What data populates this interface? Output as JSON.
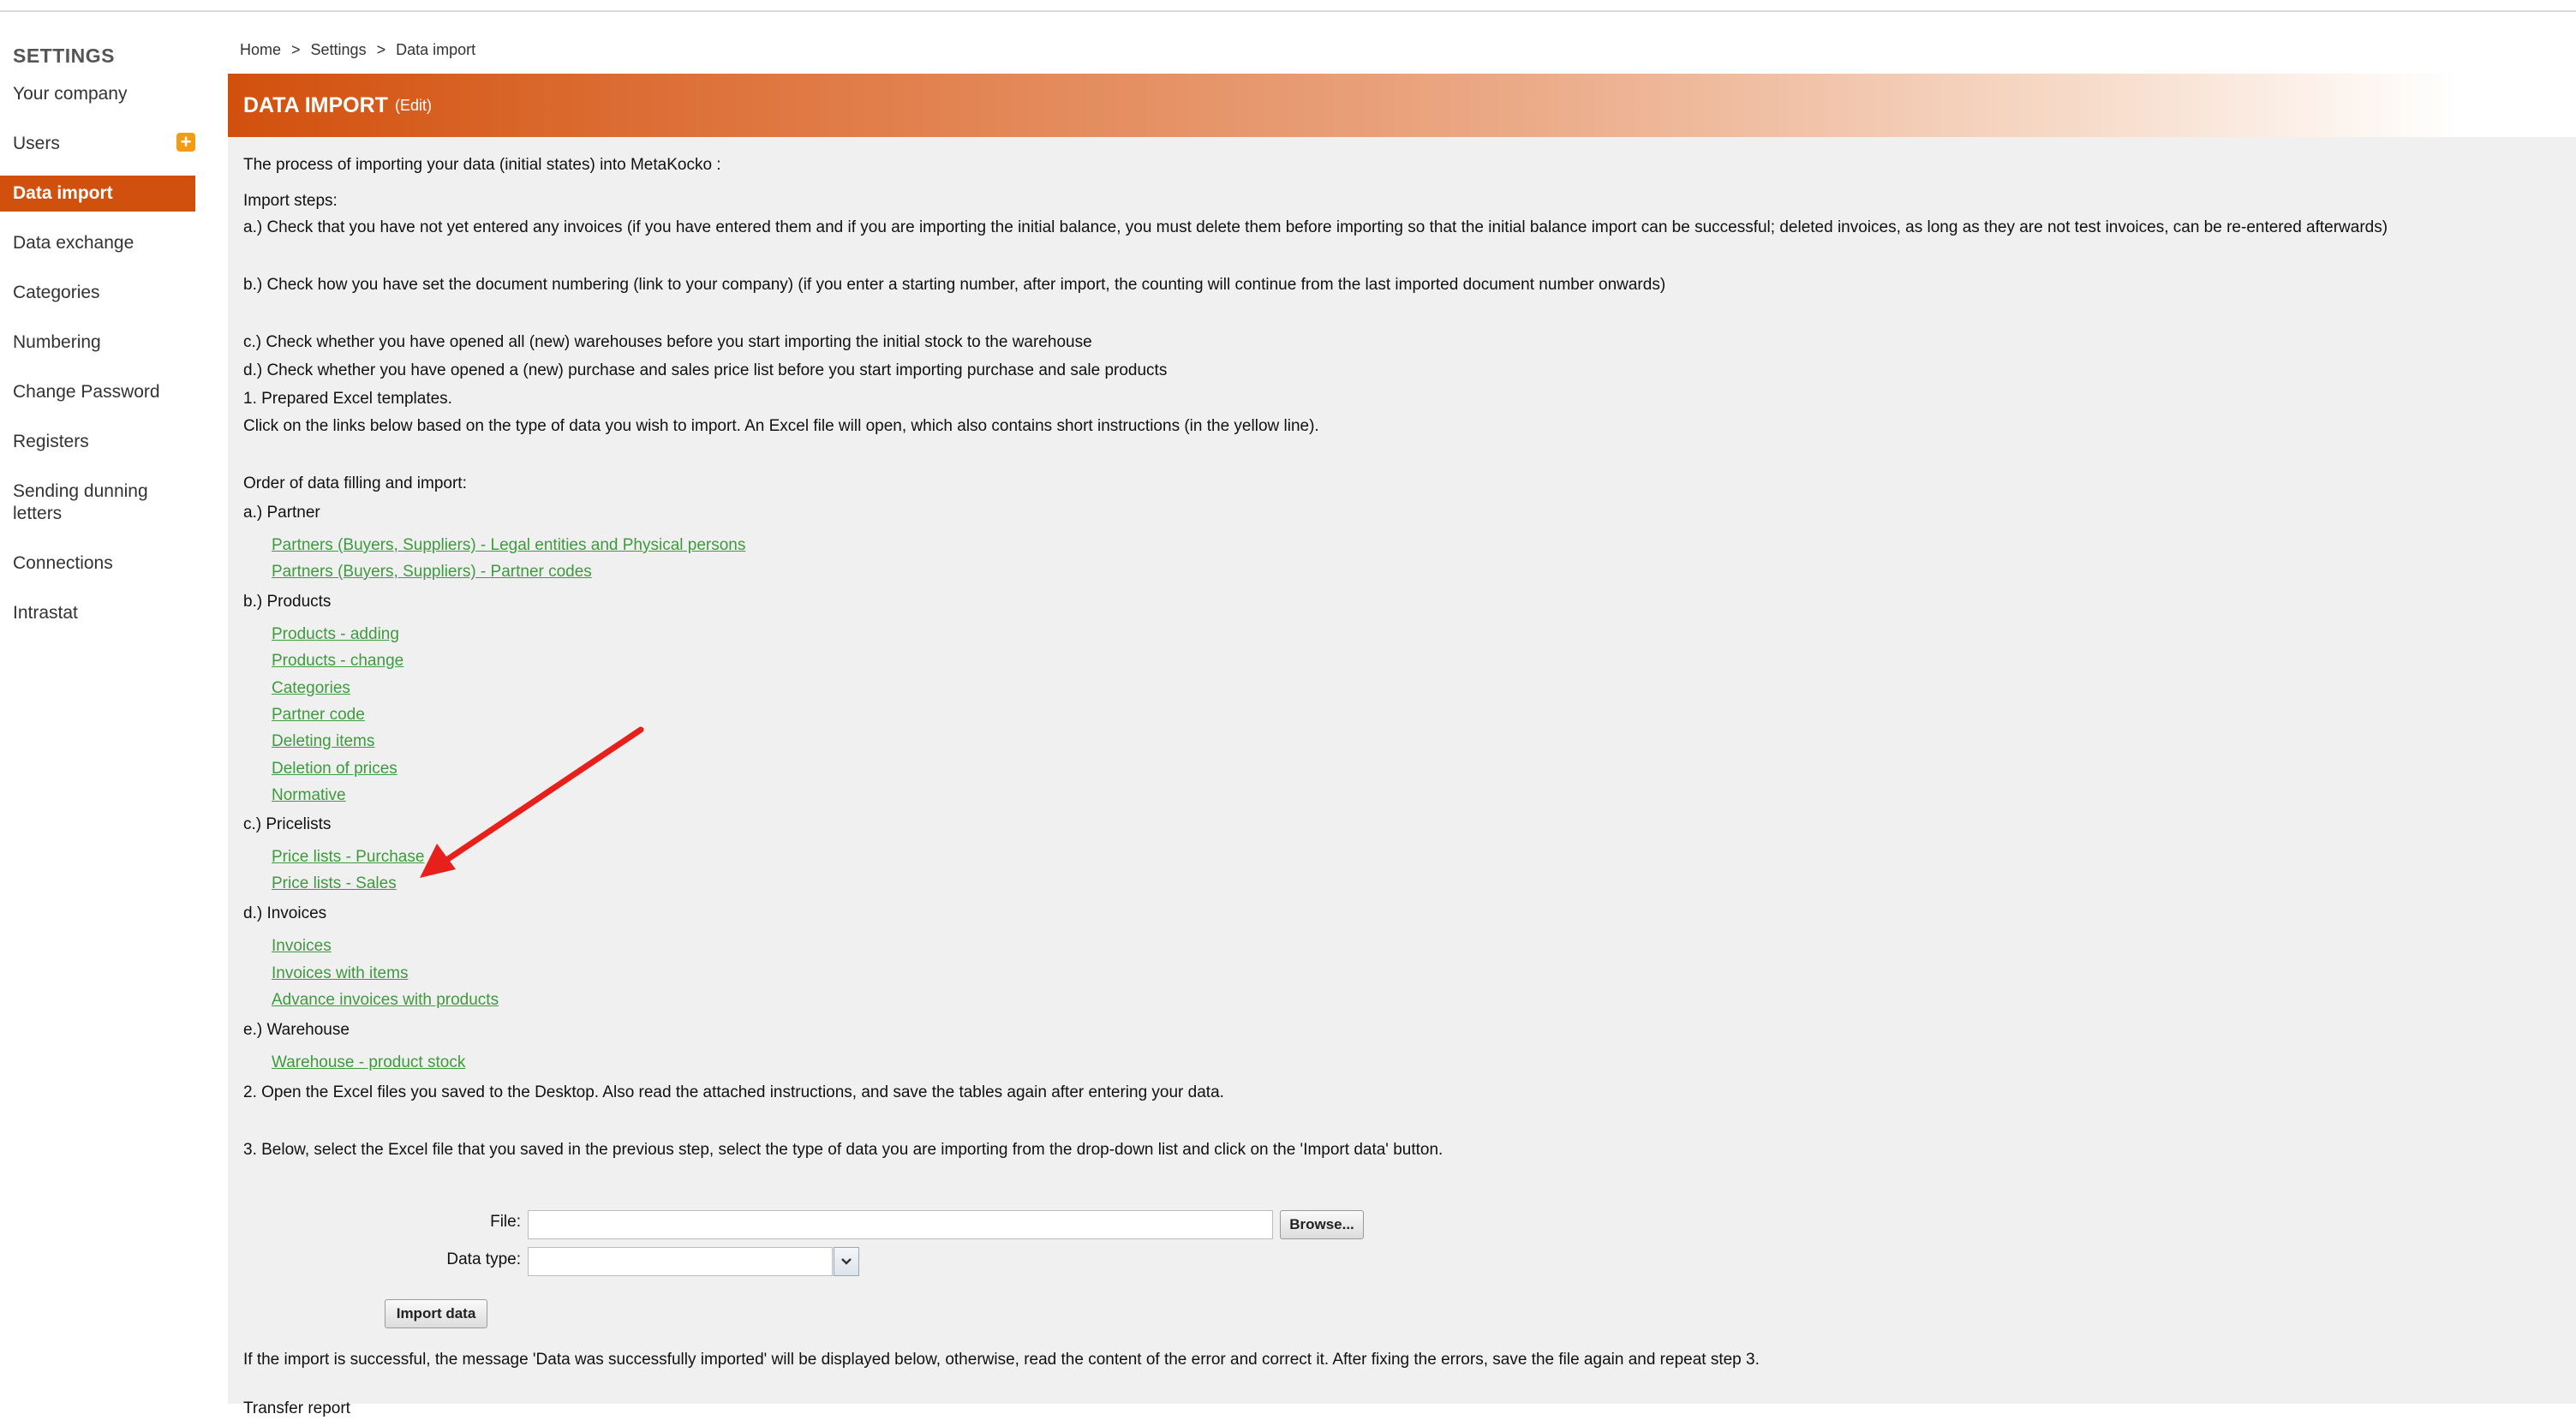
{
  "sidebar": {
    "title": "SETTINGS",
    "items": [
      {
        "label": "Your company"
      },
      {
        "label": "Users"
      },
      {
        "label": "Data import"
      },
      {
        "label": "Data exchange"
      },
      {
        "label": "Categories"
      },
      {
        "label": "Numbering"
      },
      {
        "label": "Change Password"
      },
      {
        "label": "Registers"
      },
      {
        "label": "Sending dunning letters"
      },
      {
        "label": "Connections"
      },
      {
        "label": "Intrastat"
      }
    ],
    "add_icon_glyph": "+"
  },
  "breadcrumb": {
    "home": "Home",
    "settings": "Settings",
    "current": "Data import",
    "separator": ">"
  },
  "header": {
    "title": "DATA IMPORT",
    "edit": "(Edit)"
  },
  "content": {
    "intro": "The process of importing your data (initial states) into MetaKocko :",
    "steps_title": "Import steps:",
    "step_a": "a.) Check that you have not yet entered any invoices (if you have entered them and if you are importing the initial balance, you must delete them before importing so that the initial balance import can be successful; deleted invoices, as long as they are not test invoices, can be re-entered afterwards)",
    "step_b": "b.) Check how you have set the document numbering (link to your company) (if you enter a starting number, after import, the counting will continue from the last imported document number onwards)",
    "step_c": "c.) Check whether you have opened all (new) warehouses before you start importing the initial stock to the warehouse",
    "step_d": "d.) Check whether you have opened a (new) purchase and sales price list before you start importing purchase and sale products",
    "prepared": "1. Prepared Excel templates.",
    "click_info": "Click on the links below based on the type of data you wish to import. An Excel file will open, which also contains short instructions (in the yellow line).",
    "order": "Order of data filling and import:",
    "group_a": "a.) Partner",
    "link_partners_legal": "Partners (Buyers, Suppliers) - Legal entities and Physical persons",
    "link_partners_codes": "Partners (Buyers, Suppliers) - Partner codes",
    "group_b": "b.) Products",
    "link_products_adding": "Products - adding",
    "link_products_change": "Products - change",
    "link_categories": "Categories",
    "link_partner_code": "Partner code",
    "link_deleting_items": "Deleting items",
    "link_deletion_prices": "Deletion of prices",
    "link_normative": "Normative",
    "group_c": "c.) Pricelists",
    "link_price_purchase": "Price lists - Purchase",
    "link_price_sales": "Price lists - Sales",
    "group_d": "d.) Invoices",
    "link_invoices": "Invoices",
    "link_invoices_items": "Invoices with items",
    "link_advance_invoices": "Advance invoices with products",
    "group_e": "e.) Warehouse",
    "link_warehouse_stock": "Warehouse - product stock",
    "step2": "2. Open the Excel files you saved to the Desktop. Also read the attached instructions, and save the tables again after entering your data.",
    "step3": "3. Below, select the Excel file that you saved in the previous step, select the type of data you are importing from the drop-down list and click on the 'Import data' button.",
    "result_info": "If the import is successful, the message 'Data was successfully imported' will be displayed below, otherwise, read the content of the error and correct it. After fixing the errors, save the file again and repeat step 3.",
    "transfer_report": "Transfer report"
  },
  "form": {
    "file_label": "File:",
    "file_value": "",
    "browse_label": "Browse...",
    "data_type_label": "Data type:",
    "data_type_value": "",
    "import_label": "Import data"
  },
  "colors": {
    "accent": "#d2500d",
    "link": "#3e9a3e",
    "annotation_arrow": "#e8201c"
  }
}
